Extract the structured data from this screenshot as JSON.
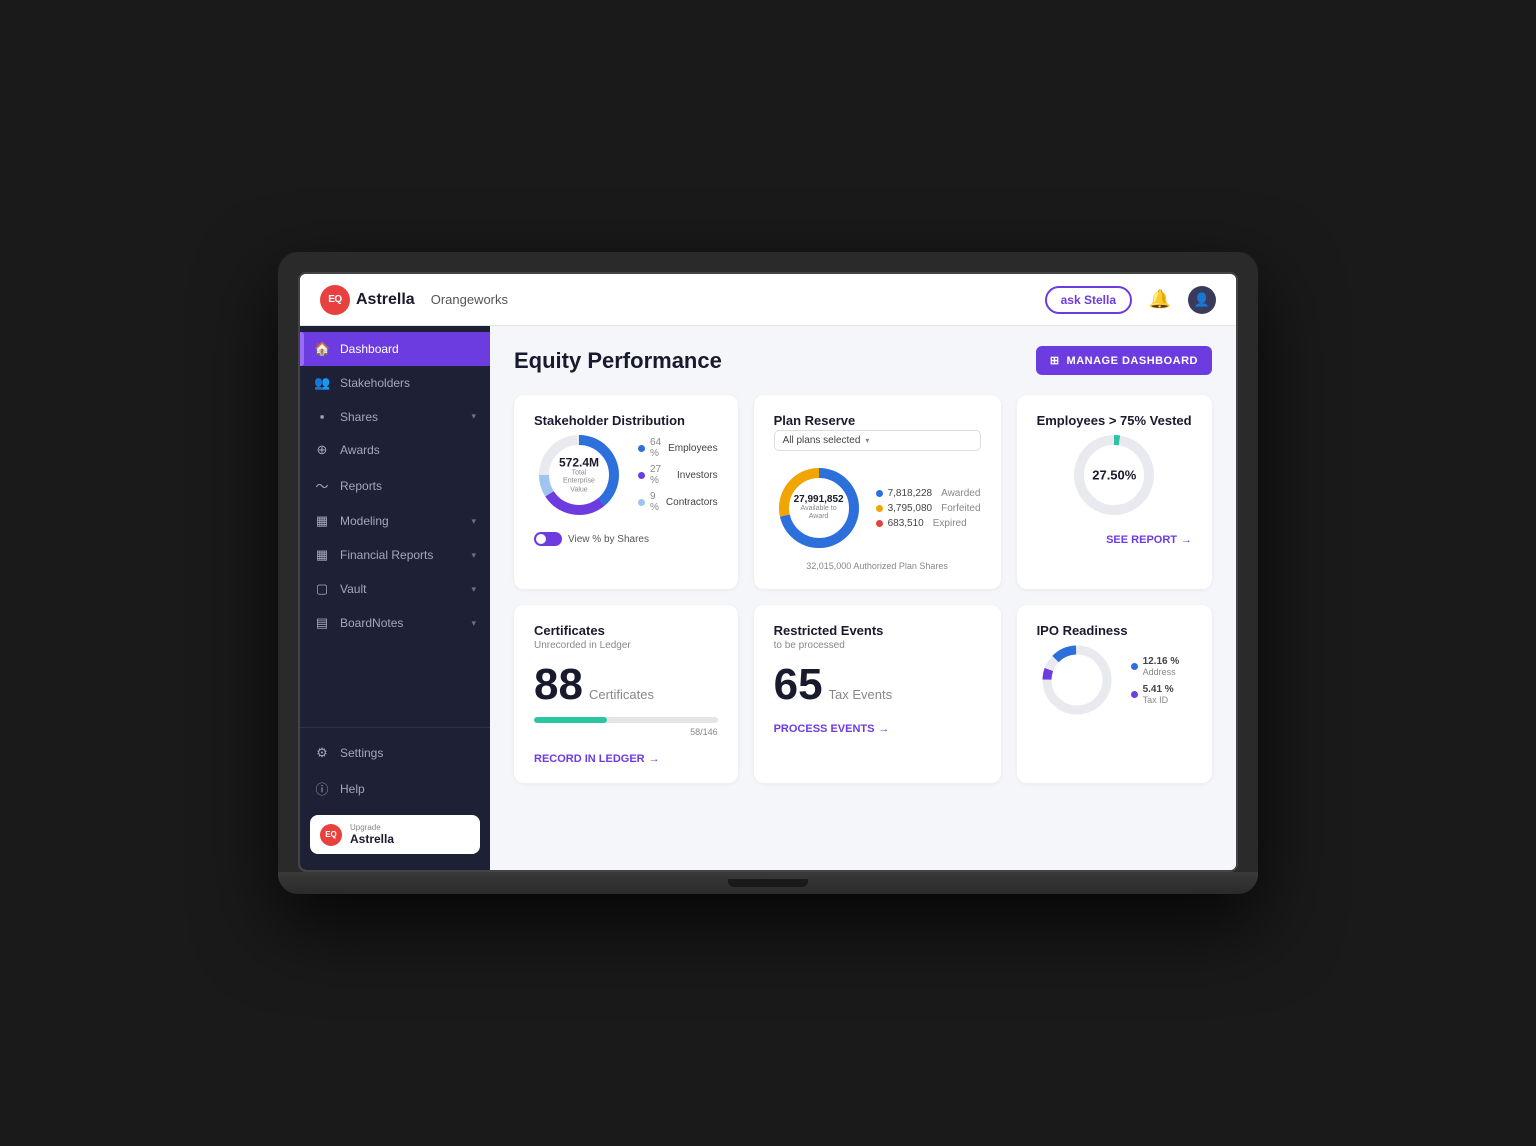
{
  "header": {
    "logo_text": "Astrella",
    "logo_abbr": "EQ",
    "company": "Orangeworks",
    "ask_stella_label": "ask Stella",
    "manage_btn_label": "MANAGE DASHBOARD"
  },
  "page": {
    "title": "Equity Performance"
  },
  "sidebar": {
    "items": [
      {
        "id": "dashboard",
        "label": "Dashboard",
        "icon": "🏠",
        "active": true
      },
      {
        "id": "stakeholders",
        "label": "Stakeholders",
        "icon": "👥",
        "active": false
      },
      {
        "id": "shares",
        "label": "Shares",
        "icon": "◼",
        "active": false,
        "hasArrow": true
      },
      {
        "id": "awards",
        "label": "Awards",
        "icon": "⊙",
        "active": false
      },
      {
        "id": "reports",
        "label": "Reports",
        "icon": "〜",
        "active": false
      },
      {
        "id": "modeling",
        "label": "Modeling",
        "icon": "▦",
        "active": false,
        "hasArrow": true
      },
      {
        "id": "financial-reports",
        "label": "Financial Reports",
        "icon": "▦",
        "active": false,
        "hasArrow": true
      },
      {
        "id": "vault",
        "label": "Vault",
        "icon": "▢",
        "active": false,
        "hasArrow": true
      },
      {
        "id": "boardnotes",
        "label": "BoardNotes",
        "icon": "▤",
        "active": false,
        "hasArrow": true
      }
    ],
    "bottom_items": [
      {
        "id": "settings",
        "label": "Settings",
        "icon": "⚙"
      },
      {
        "id": "help",
        "label": "Help",
        "icon": "ⓘ"
      }
    ],
    "upgrade": {
      "label": "Upgrade",
      "brand": "Astrella"
    }
  },
  "cards": {
    "stakeholder": {
      "title": "Stakeholder Distribution",
      "center_value": "572.4M",
      "center_label": "Total Enterprise\nValue",
      "legend": [
        {
          "label": "Employees",
          "pct": "64 %",
          "color": "#2d6fdb"
        },
        {
          "label": "Investors",
          "pct": "27 %",
          "color": "#6c3ce1"
        },
        {
          "label": "Contractors",
          "pct": "9 %",
          "color": "#a0c4f0"
        }
      ],
      "toggle_label": "View % by Shares",
      "donut_segments": [
        {
          "pct": 64,
          "color": "#2d6fdb"
        },
        {
          "pct": 27,
          "color": "#6c3ce1"
        },
        {
          "pct": 9,
          "color": "#a0c4f0"
        }
      ]
    },
    "plan_reserve": {
      "title": "Plan Reserve",
      "dropdown_label": "All plans selected",
      "center_value": "27,991,852",
      "center_label": "Available to\nAward",
      "legend": [
        {
          "label": "Awarded",
          "value": "7,818,228",
          "color": "#2d6fdb"
        },
        {
          "label": "Forfeited",
          "value": "3,795,080",
          "color": "#f0a500"
        },
        {
          "label": "Expired",
          "value": "683,510",
          "color": "#e84040"
        }
      ],
      "authorized_label": "32,015,000 Authorized Plan Shares"
    },
    "employees_vested": {
      "title": "Employees > 75% Vested",
      "center_value": "27.50%",
      "see_report_label": "SEE REPORT"
    },
    "certificates": {
      "title": "Certificates",
      "subtitle": "Unrecorded in Ledger",
      "number": "88",
      "unit": "Certificates",
      "progress_value": 40,
      "progress_label": "58/146",
      "action_label": "RECORD IN LEDGER"
    },
    "restricted_events": {
      "title": "Restricted Events",
      "subtitle": "to be processed",
      "number": "65",
      "unit": "Tax Events",
      "action_label": "PROCESS EVENTS"
    },
    "ipo_readiness": {
      "title": "IPO Readiness",
      "legend": [
        {
          "label": "Address",
          "pct": "12.16 %",
          "color": "#2d6fdb"
        },
        {
          "label": "Tax ID",
          "pct": "5.41 %",
          "color": "#6c3ce1"
        }
      ]
    }
  }
}
